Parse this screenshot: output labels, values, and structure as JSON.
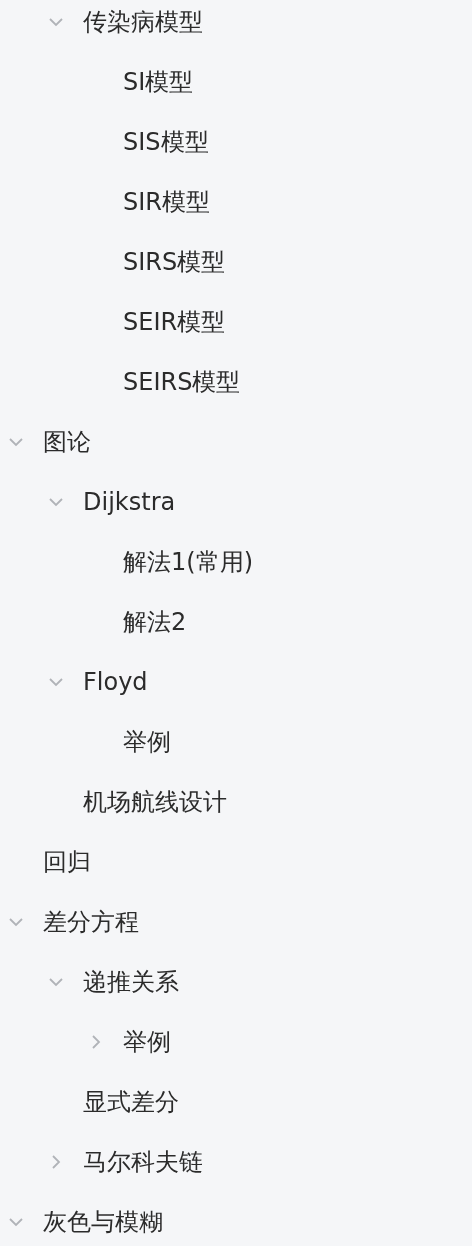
{
  "outline": {
    "items": [
      {
        "children": [
          {
            "label": "传染病模型",
            "expanded": true,
            "children": [
              {
                "label": "SI模型"
              },
              {
                "label": "SIS模型"
              },
              {
                "label": "SIR模型"
              },
              {
                "label": "SIRS模型"
              },
              {
                "label": "SEIR模型"
              },
              {
                "label": "SEIRS模型"
              }
            ]
          }
        ]
      },
      {
        "label": "图论",
        "expanded": true,
        "children": [
          {
            "label": "Dijkstra",
            "expanded": true,
            "children": [
              {
                "label": "解法1(常用)"
              },
              {
                "label": "解法2"
              }
            ]
          },
          {
            "label": "Floyd",
            "expanded": true,
            "children": [
              {
                "label": "举例"
              }
            ]
          },
          {
            "label": "机场航线设计"
          }
        ]
      },
      {
        "label": "回归"
      },
      {
        "label": "差分方程",
        "expanded": true,
        "children": [
          {
            "label": "递推关系",
            "expanded": true,
            "children": [
              {
                "label": "举例",
                "expanded": false
              }
            ]
          },
          {
            "label": "显式差分"
          },
          {
            "label": "马尔科夫链",
            "expanded": false
          }
        ]
      },
      {
        "label": "灰色与模糊",
        "expanded": true
      }
    ]
  }
}
